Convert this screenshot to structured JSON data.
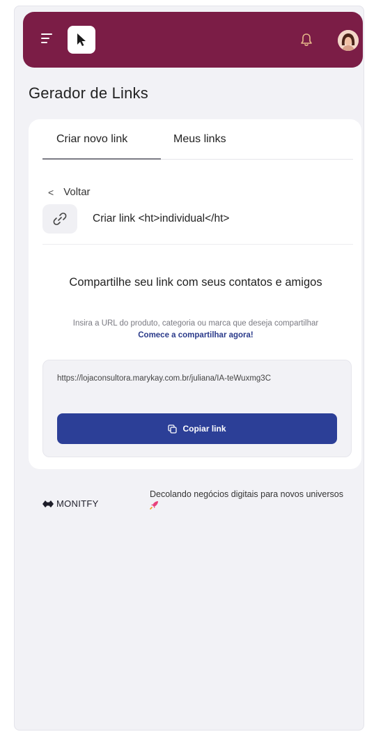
{
  "header": {
    "menu_icon": "menu-icon",
    "logo_icon": "cursor-arrow-icon",
    "notification_icon": "bell-icon",
    "avatar": "user-avatar",
    "brand_color": "#7b1d46"
  },
  "page": {
    "title": "Gerador de Links"
  },
  "tabs": [
    {
      "label": "Criar novo link",
      "active": true
    },
    {
      "label": "Meus links",
      "active": false
    }
  ],
  "back": {
    "label": "Voltar"
  },
  "link_type": {
    "label": "Criar link <ht>individual</ht>",
    "icon": "link-icon"
  },
  "share": {
    "title": "Compartilhe seu link com seus contatos e amigos",
    "description": "Insira a URL do produto, categoria ou marca que deseja compartilhar",
    "cta": "Comece a compartilhar agora!"
  },
  "generated": {
    "url": "https://lojaconsultora.marykay.com.br/juliana/IA-teWuxmg3C",
    "copy_label": "Copiar link",
    "button_color": "#2c3f97"
  },
  "footer": {
    "brand": "MONITFY",
    "tagline": "Decolando negócios digitais para novos universos",
    "tagline_icon": "rocket-icon"
  }
}
